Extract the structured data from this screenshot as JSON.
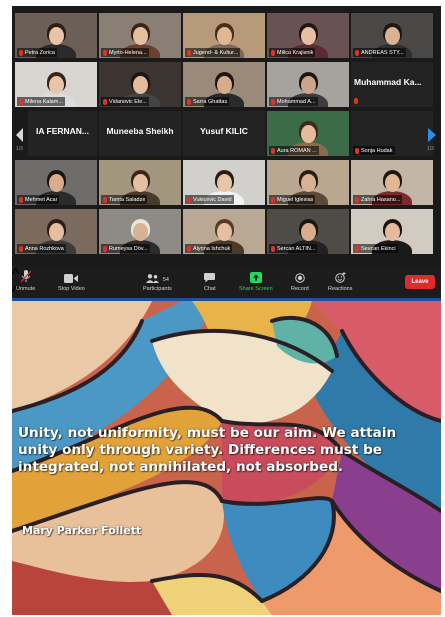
{
  "participants": [
    {
      "name": "Petra Zorica",
      "row": 0,
      "col": 0,
      "bg": "#6b5f57",
      "skin": "#e8c3a6",
      "hair": "#2c1d17",
      "shirt": "#2a2a2a"
    },
    {
      "name": "Myrto-Helena...",
      "row": 0,
      "col": 1,
      "bg": "#8a7f75",
      "skin": "#e6bfa1",
      "hair": "#3a2418",
      "shirt": "#6c4030"
    },
    {
      "name": "Jugend- & Kultur...",
      "row": 0,
      "col": 2,
      "bg": "#b69a79",
      "skin": "#e2b894",
      "hair": "#4a2c1c",
      "shirt": "#7c6a56"
    },
    {
      "name": "Milica Krajisnik",
      "row": 0,
      "col": 3,
      "bg": "#6b5252",
      "skin": "#e6bea1",
      "hair": "#1f1513",
      "shirt": "#5a2c32"
    },
    {
      "name": "ANDREAS STY...",
      "row": 0,
      "col": 4,
      "bg": "#4b4848",
      "skin": "#d9b193",
      "hair": "#1c1714",
      "shirt": "#2e2e2e"
    },
    {
      "name": "Milena Kalam...",
      "row": 1,
      "col": 0,
      "bg": "#d9d6d1",
      "skin": "#e8c4a8",
      "hair": "#3a2418",
      "shirt": "#dcdcdc"
    },
    {
      "name": "Vidanovic Ele...",
      "row": 1,
      "col": 1,
      "bg": "#3b3431",
      "skin": "#e4bb9c",
      "hair": "#1d1410",
      "shirt": "#444"
    },
    {
      "name": "Sarra Ghattas",
      "row": 1,
      "col": 2,
      "bg": "#9a8a79",
      "skin": "#d6ad8c",
      "hair": "#201510",
      "shirt": "#2a2a2a"
    },
    {
      "name": "Mohammad A...",
      "row": 1,
      "col": 3,
      "bg": "#a6a39e",
      "skin": "#cda488",
      "hair": "#1c1714",
      "shirt": "#3c3c3c"
    },
    {
      "name": "Aura ROMAN ...",
      "row": 2,
      "col": 3,
      "bg": "#3c6b47",
      "skin": "#e4bb9c",
      "hair": "#3e2a1c",
      "shirt": "#8a6b4d"
    },
    {
      "name": "Sonja Hudak",
      "row": 2,
      "col": 4,
      "bg": "#232323",
      "skin": "#232323",
      "hair": "#232323",
      "shirt": "#232323"
    },
    {
      "name": "Mehmet Acar",
      "row": 3,
      "col": 0,
      "bg": "#6e6d6c",
      "skin": "#d8ad8c",
      "hair": "#1b1512",
      "shirt": "#2b2b2b"
    },
    {
      "name": "Tamta Saladze",
      "row": 3,
      "col": 1,
      "bg": "#a2967f",
      "skin": "#e6bfa1",
      "hair": "#3a2418",
      "shirt": "#4a3a2c"
    },
    {
      "name": "Vukicevic David",
      "row": 3,
      "col": 2,
      "bg": "#d1d0cc",
      "skin": "#e8c4a8",
      "hair": "#2a1c14",
      "shirt": "#f2f2f2"
    },
    {
      "name": "Miguel Iglesias",
      "row": 3,
      "col": 3,
      "bg": "#b9a791",
      "skin": "#d9b193",
      "hair": "#2a1c14",
      "shirt": "#5a4a3a"
    },
    {
      "name": "Zahra Hasano...",
      "row": 3,
      "col": 4,
      "bg": "#c4b6a7",
      "skin": "#e2b894",
      "hair": "#1f1513",
      "shirt": "#7a2c2c"
    },
    {
      "name": "Anna Rozhkova",
      "row": 4,
      "col": 0,
      "bg": "#7b6a5e",
      "skin": "#e6bea1",
      "hair": "#2c1d17",
      "shirt": "#3b3b3b"
    },
    {
      "name": "Rumeysa Döv...",
      "row": 4,
      "col": 1,
      "bg": "#8e8b86",
      "skin": "#d9b193",
      "hair": "#e9e4dc",
      "shirt": "#2c2c2c"
    },
    {
      "name": "Alyona Ishchuk",
      "row": 4,
      "col": 2,
      "bg": "#b8a894",
      "skin": "#e6bfa1",
      "hair": "#5a3a22",
      "shirt": "#4a3a2c"
    },
    {
      "name": "Sercan ALTIN...",
      "row": 4,
      "col": 3,
      "bg": "#4f4b47",
      "skin": "#d8ad8c",
      "hair": "#1b1512",
      "shirt": "#222"
    },
    {
      "name": "Sevcan Ekinci",
      "row": 4,
      "col": 4,
      "bg": "#d2cbc2",
      "skin": "#e4bb9c",
      "hair": "#1d1410",
      "shirt": "#1a1a1a"
    }
  ],
  "text_tiles": [
    {
      "name": "Muhammad Ka...",
      "row": 1,
      "col": 4
    },
    {
      "name": "IA FERNAN...",
      "row": 2,
      "col": 0
    },
    {
      "name": "Muneeba Sheikh",
      "row": 2,
      "col": 1
    },
    {
      "name": "Yusuf KILIC",
      "row": 2,
      "col": 2
    }
  ],
  "pagination": {
    "left": "1/3",
    "right": "1/3"
  },
  "toolbar": {
    "unmute": "Unmute",
    "stop_video": "Stop Video",
    "participants": "Participants",
    "participant_count": "54",
    "chat": "Chat",
    "share_screen": "Share Screen",
    "record": "Record",
    "reactions": "Reactions",
    "leave": "Leave"
  },
  "colors": {
    "share_green": "#23d959",
    "leave_red": "#e02b2b",
    "mute_red": "#e0312b",
    "active_border": "#c9d85a",
    "divider_blue": "#1d4f9c"
  },
  "quote": {
    "text": "Unity, not uniformity, must be our aim. We attain unity only through variety. Differences must be integrated, not annihilated, not absorbed.",
    "author": "Mary Parker Follett"
  }
}
